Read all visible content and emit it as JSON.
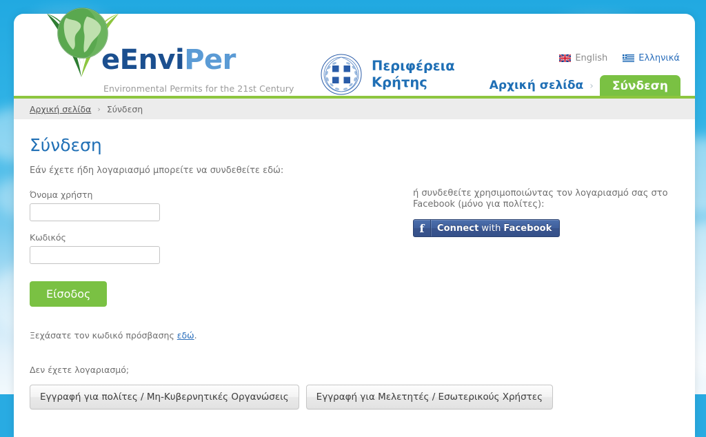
{
  "branding": {
    "logo_name_dark": "eEnvi",
    "logo_name_light": "Per",
    "tagline": "Environmental Permits for the 21st Century",
    "region_line1": "Περιφέρεια",
    "region_line2": "Κρήτης",
    "accent_green": "#7ac143",
    "accent_blue": "#1f6fb5",
    "rule_green": "#8dc63f"
  },
  "language": {
    "english": "English",
    "greek": "Ελληνικά"
  },
  "nav": {
    "home": "Αρχική σελίδα",
    "separator": "›",
    "login": "Σύνδεση"
  },
  "breadcrumb": {
    "home": "Αρχική σελίδα",
    "separator": "›",
    "current": "Σύνδεση"
  },
  "login": {
    "title": "Σύνδεση",
    "intro": "Εάν έχετε ήδη λογαριασμό μπορείτε να συνδεθείτε εδώ:",
    "username_label": "Όνομα χρήστη",
    "username_value": "",
    "password_label": "Κωδικός",
    "password_value": "",
    "submit_label": "Είσοδος",
    "forgot_prefix": "Ξεχάσατε τον κωδικό πρόσβασης ",
    "forgot_link": "εδώ",
    "forgot_suffix": ".",
    "no_account": "Δεν έχετε λογαριασμό;",
    "register_citizens": "Εγγραφή για πολίτες / Μη-Κυβερνητικές Οργανώσεις",
    "register_professionals": "Εγγραφή για Μελετητές / Εσωτερικούς Χρήστες"
  },
  "facebook": {
    "intro": "ή συνδεθείτε χρησιμοποιώντας τον λογαριασμό σας στο Facebook (μόνο για πολίτες):",
    "icon_letter": "f",
    "label_bold1": "Connect",
    "label_thin": "with",
    "label_bold2": "Facebook",
    "brand_color": "#3b5998"
  }
}
